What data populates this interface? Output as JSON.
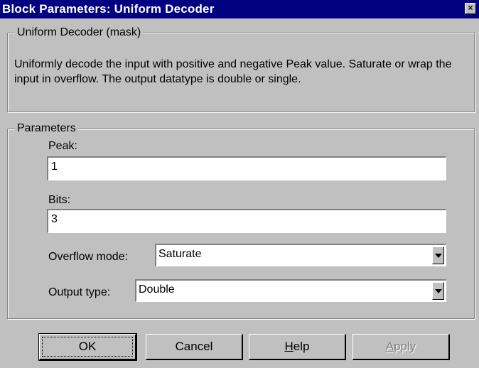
{
  "window": {
    "title": "Block Parameters: Uniform Decoder",
    "close_glyph": "×"
  },
  "mask_group": {
    "legend": "Uniform Decoder (mask)",
    "description": "Uniformly decode the input with positive and negative Peak value. Saturate or wrap the input in overflow.  The  output datatype is double or single."
  },
  "params_group": {
    "legend": "Parameters",
    "peak": {
      "label": "Peak:",
      "value": "1"
    },
    "bits": {
      "label": "Bits:",
      "value": "3"
    },
    "overflow_mode": {
      "label": "Overflow mode:",
      "value": "Saturate"
    },
    "output_type": {
      "label": "Output type:",
      "value": "Double"
    }
  },
  "buttons": {
    "ok": "OK",
    "cancel": "Cancel",
    "help_first": "H",
    "help_rest": "elp",
    "apply_first": "A",
    "apply_rest": "pply"
  }
}
